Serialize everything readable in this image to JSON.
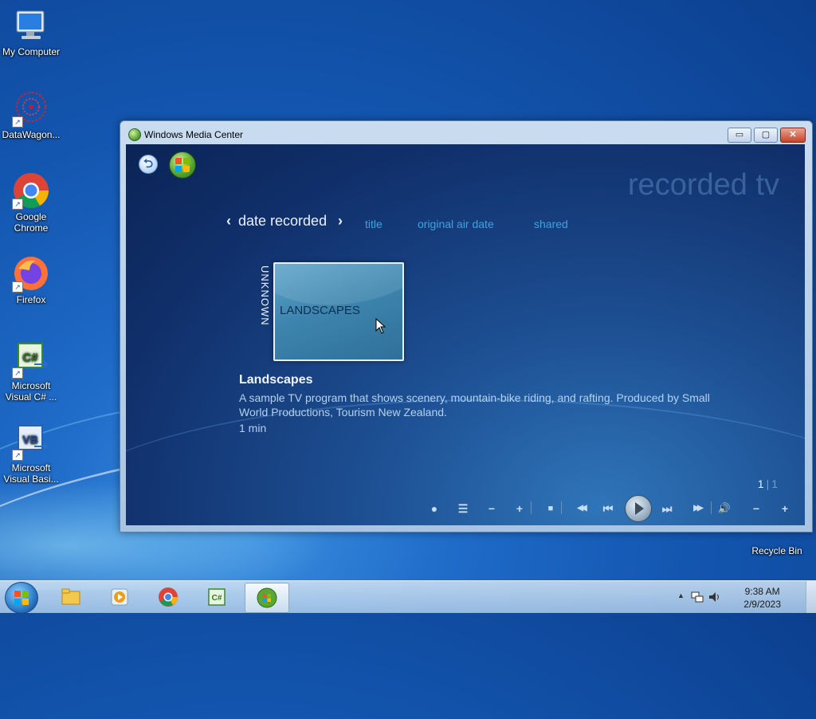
{
  "desktop": {
    "icons": [
      {
        "label": "My Computer"
      },
      {
        "label": "DataWagon..."
      },
      {
        "label": "Google Chrome"
      },
      {
        "label": "Firefox"
      },
      {
        "label": "Microsoft Visual C# ..."
      },
      {
        "label": "Microsoft Visual Basi..."
      },
      {
        "label": "Recycle Bin"
      }
    ]
  },
  "window": {
    "title": "Windows Media Center",
    "controls": {
      "minimize": "▭",
      "maximize": "▢",
      "close": "✕"
    }
  },
  "media_center": {
    "section_title": "recorded tv",
    "back_icon": "back-arrow-icon",
    "tabs": {
      "active": "date recorded",
      "prev_arrow": "‹",
      "next_arrow": "›",
      "others": [
        "title",
        "original air date",
        "shared"
      ]
    },
    "group_label": "UNKNOWN",
    "tile": {
      "title": "LANDSCAPES"
    },
    "details": {
      "title": "Landscapes",
      "description": "A sample TV program that shows scenery, mountain-bike riding, and rafting. Produced by Small World Productions, Tourism New Zealand.",
      "duration": "1 min"
    },
    "pager": {
      "current": "1",
      "separator": "|",
      "total": "1"
    },
    "transport": {
      "record": "●",
      "guide": "☰",
      "ch_down": "−",
      "ch_up": "+",
      "stop": "■",
      "rewind": "◀◀",
      "prev": "⏮",
      "next": "⏭",
      "ffwd": "▶▶",
      "volume": "🔊",
      "vol_down": "−",
      "vol_up": "+"
    }
  },
  "taskbar": {
    "clock_time": "9:38 AM",
    "clock_date": "2/9/2023",
    "tray_arrow": "▲"
  },
  "colors": {
    "accent_tab": "#3aa4e0",
    "text_light": "#e8f1fb",
    "desc_text": "#b4d2ee"
  }
}
